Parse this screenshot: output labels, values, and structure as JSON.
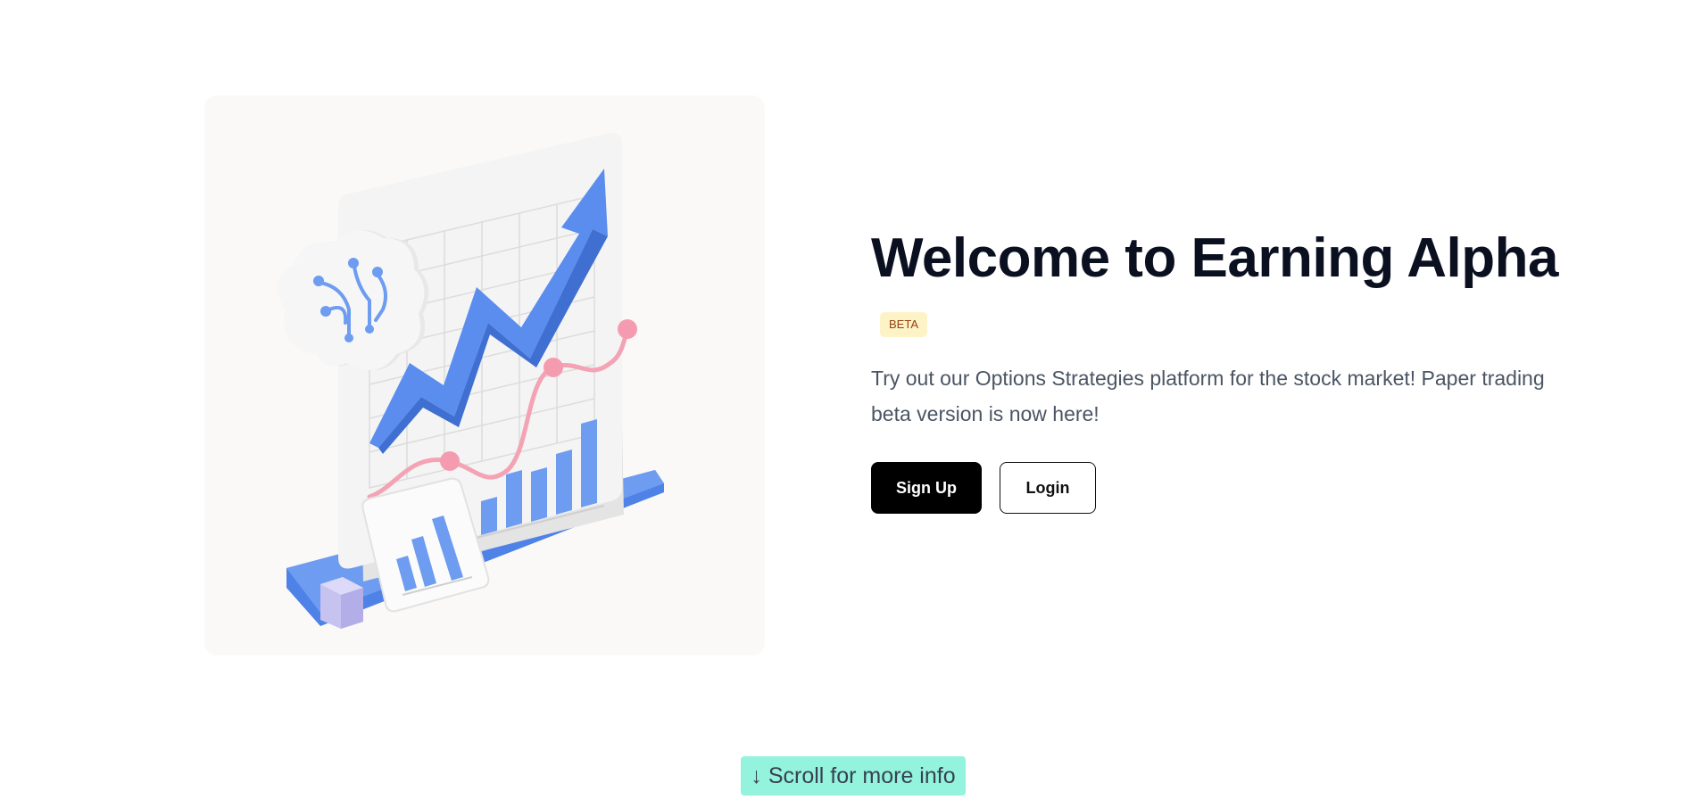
{
  "hero": {
    "title": "Welcome to Earning Alpha",
    "badge": "BETA",
    "description": "Try out our Options Strategies platform for the stock market! Paper trading beta version is now here!",
    "signup_label": "Sign Up",
    "login_label": "Login"
  },
  "illustration": {
    "icon": "growth-chart-illustration",
    "colors": {
      "accent_blue": "#5b8def",
      "line_pink": "#f4a3b4",
      "panel": "#f2f2f2",
      "cube": "#c7c3f0"
    }
  },
  "scroll_hint": {
    "label": "↓ Scroll for more info",
    "background": "#93f3dc"
  }
}
